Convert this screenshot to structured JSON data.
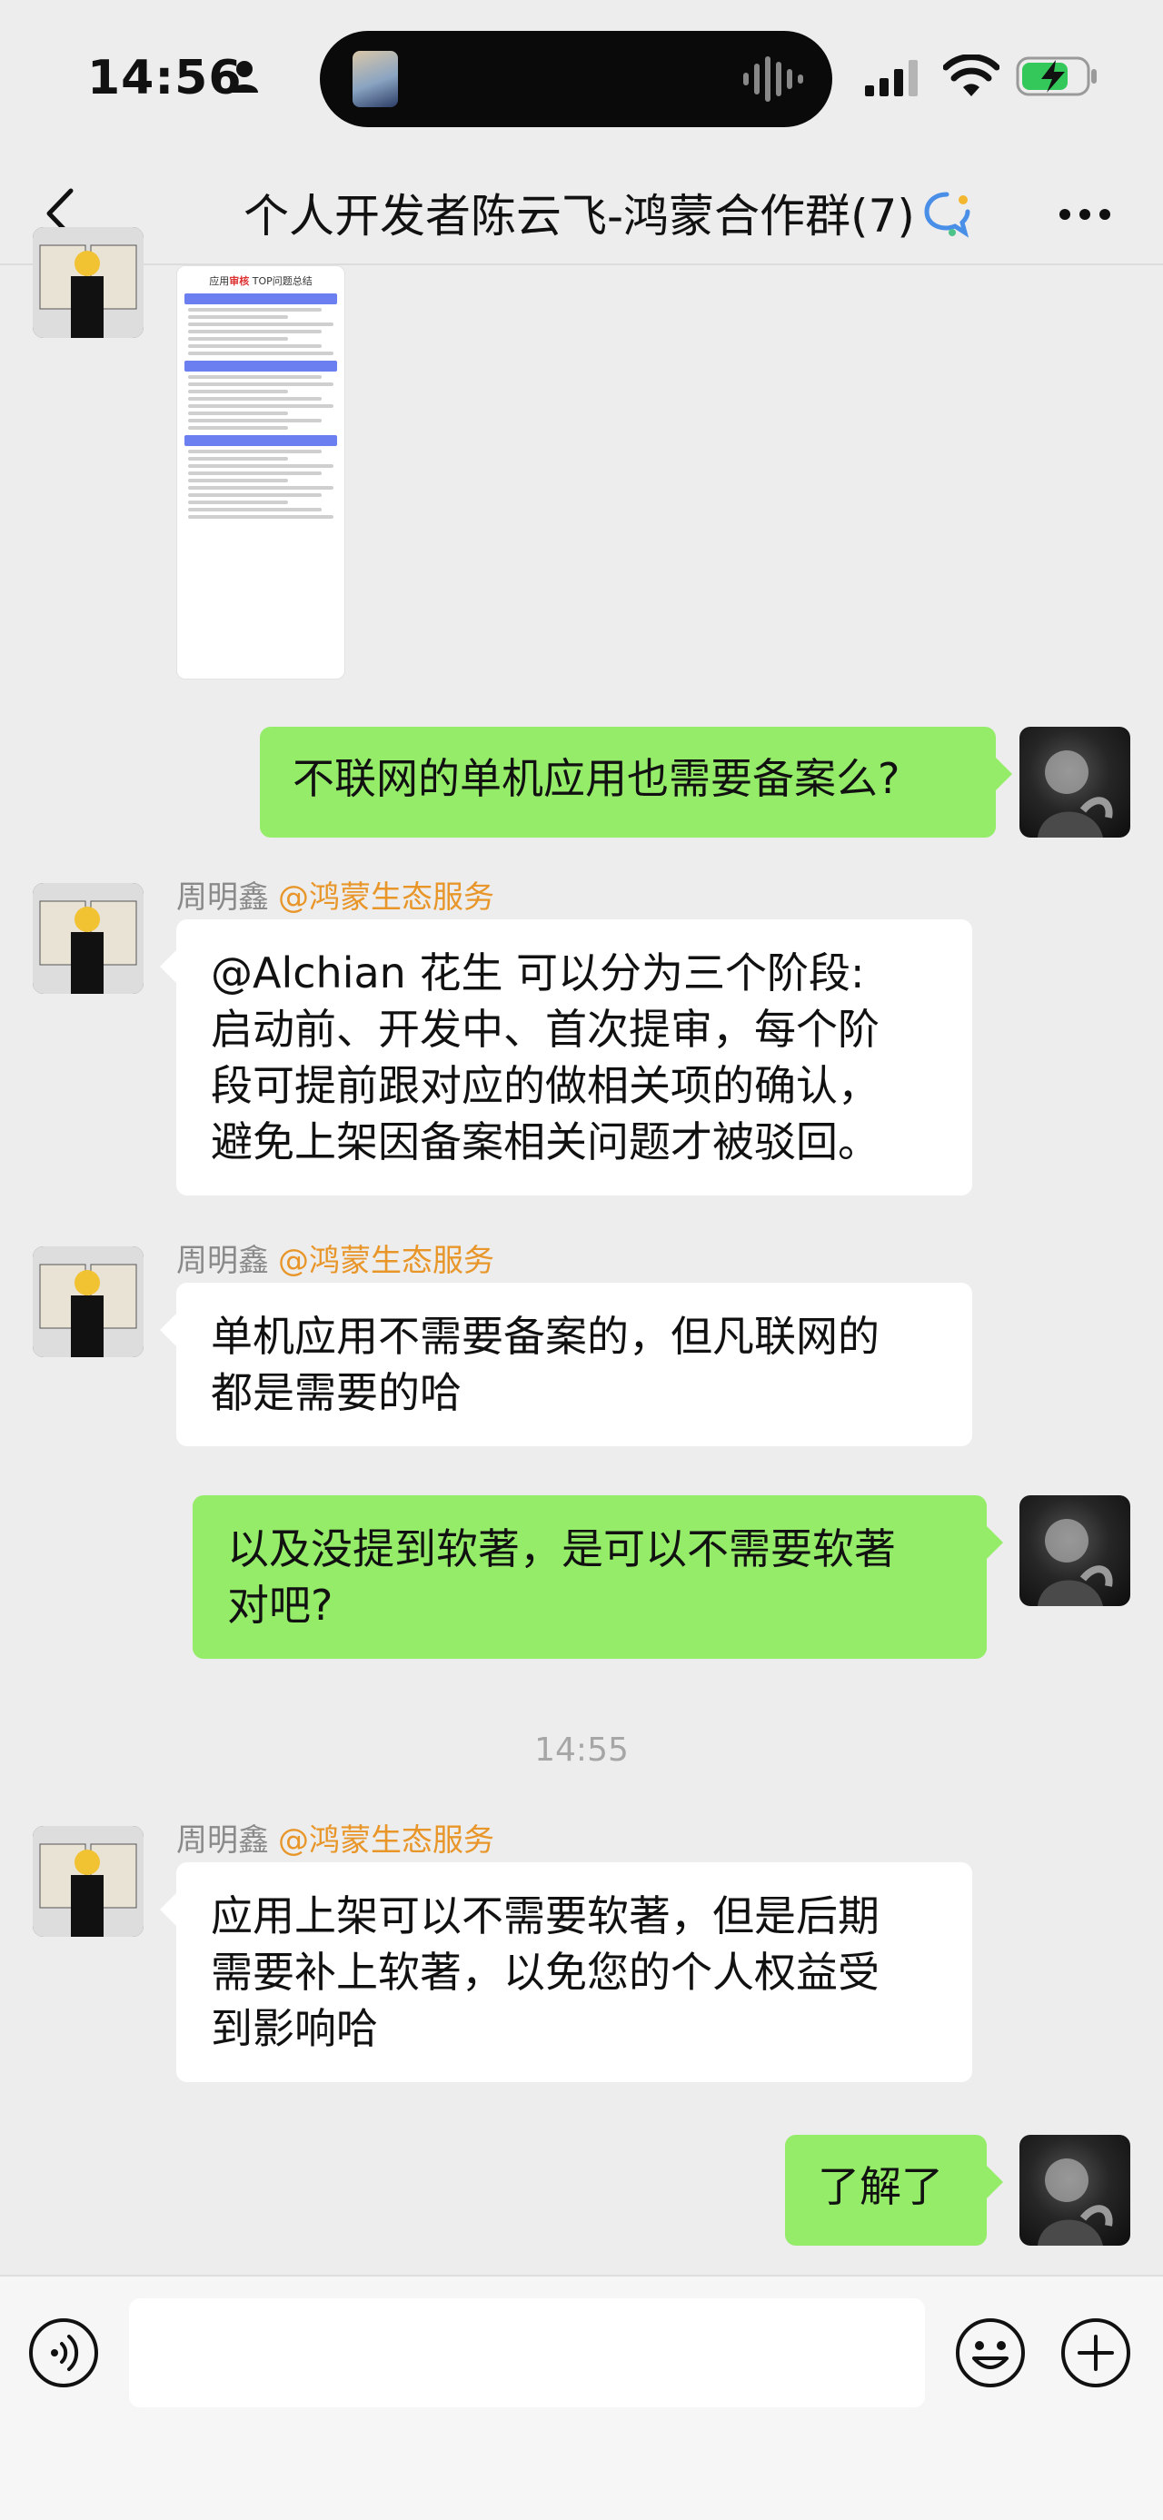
{
  "status": {
    "time": "14:56",
    "icons": [
      "person-icon",
      "signal-icon",
      "wifi-icon",
      "battery-charging-icon"
    ]
  },
  "nav": {
    "title": "个人开发者陈云飞-鸿蒙合作群(7)",
    "back_icon": "chevron-left-icon",
    "more_icon": "more-icon"
  },
  "image_message": {
    "title_prefix": "应用",
    "title_highlight": "审核",
    "title_suffix": " TOP问题总结"
  },
  "messages": [
    {
      "sender": "",
      "mention": "",
      "text": "不联网的单机应用也需要备案么?"
    },
    {
      "sender": "周明鑫",
      "mention": "@鸿蒙生态服务",
      "lines": [
        "@Alchian 花生 可以分为三个阶段:",
        "启动前、开发中、首次提审，每个阶",
        "段可提前跟对应的做相关项的确认，",
        "避免上架因备案相关问题才被驳回。"
      ]
    },
    {
      "sender": "周明鑫",
      "mention": "@鸿蒙生态服务",
      "lines": [
        "单机应用不需要备案的，但凡联网的",
        "都是需要的哈"
      ]
    },
    {
      "sender": "",
      "mention": "",
      "lines": [
        "以及没提到软著，是可以不需要软著",
        "对吧?"
      ]
    },
    {
      "sender": "周明鑫",
      "mention": "@鸿蒙生态服务",
      "lines": [
        "应用上架可以不需要软著，但是后期",
        "需要补上软著，以免您的个人权益受",
        "到影响哈"
      ]
    },
    {
      "sender": "",
      "mention": "",
      "text": "了解了"
    }
  ],
  "timestamp": "14:55",
  "input": {
    "value": "",
    "voice_icon": "voice-icon",
    "emoji_icon": "emoji-icon",
    "plus_icon": "plus-icon"
  },
  "colors": {
    "background": "#ededed",
    "bubble_green": "#95ec69",
    "bubble_white": "#ffffff",
    "mention": "#e8962a"
  }
}
